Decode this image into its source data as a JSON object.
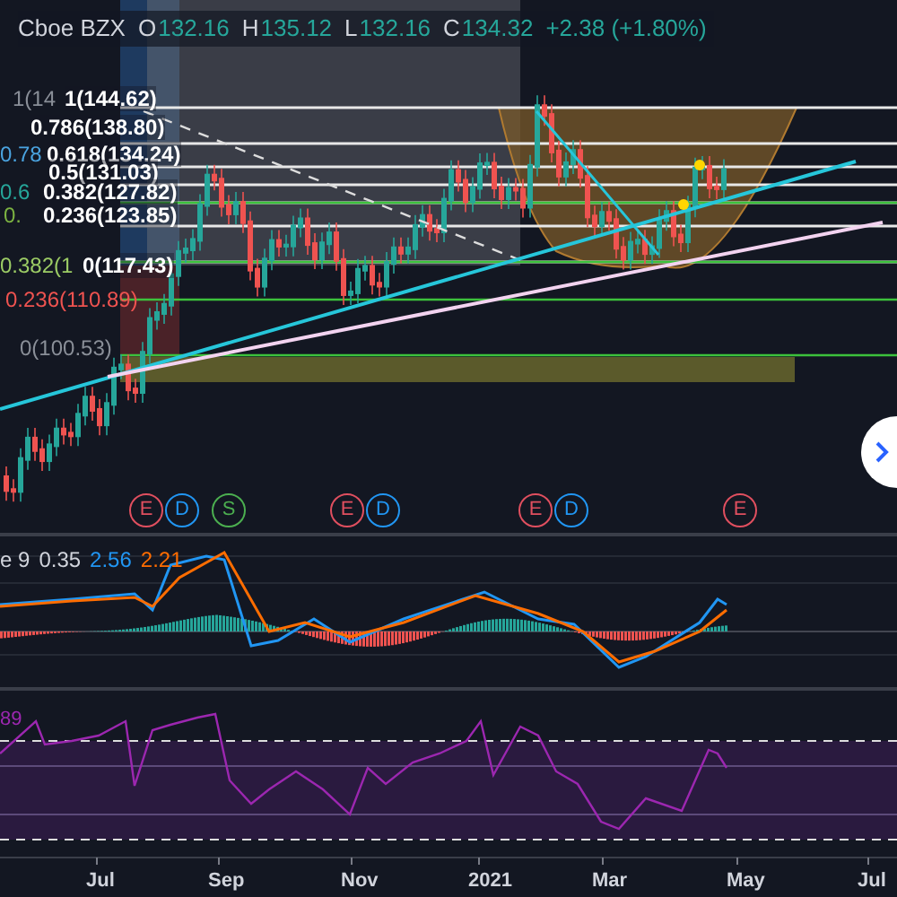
{
  "header": {
    "exchange": "Cboe BZX",
    "ohlc": [
      {
        "key": "O",
        "value": "132.16"
      },
      {
        "key": "H",
        "value": "135.12"
      },
      {
        "key": "L",
        "value": "132.16"
      },
      {
        "key": "C",
        "value": "134.32"
      }
    ],
    "change": "+2.38 (+1.80%)"
  },
  "fib_primary": [
    "1(144.62)",
    "0.786(138.80)",
    "0.618(134.24)",
    "0.5(131.03)",
    "0.382(127.82)",
    "0.236(123.85)",
    "0(117.43)"
  ],
  "fib_secondary": [
    {
      "label": "1(14",
      "color": "#8a8f98"
    },
    {
      "label": "0.78",
      "color": "#4aa3df"
    },
    {
      "label": "0.6",
      "color": "#26a69a"
    },
    {
      "label": "0.",
      "color": "#7cb342"
    },
    {
      "label": "0.382(1",
      "color": "#9ccc65"
    },
    {
      "label": "0.236(110.89)",
      "color": "#ef5350"
    },
    {
      "label": "0(100.53)",
      "color": "#8a8f98"
    }
  ],
  "events": [
    {
      "letter": "E",
      "color": "#e04f5f"
    },
    {
      "letter": "D",
      "color": "#2196f3"
    },
    {
      "letter": "S",
      "color": "#4caf50"
    },
    {
      "letter": "E",
      "color": "#e04f5f"
    },
    {
      "letter": "D",
      "color": "#2196f3"
    },
    {
      "letter": "E",
      "color": "#e04f5f"
    },
    {
      "letter": "D",
      "color": "#2196f3"
    },
    {
      "letter": "E",
      "color": "#e04f5f"
    }
  ],
  "macd": {
    "label": "e 9",
    "values": [
      {
        "text": "0.35",
        "color": "#d1d4dc"
      },
      {
        "text": "2.56",
        "color": "#2196f3"
      },
      {
        "text": "2.21",
        "color": "#ff6d00"
      }
    ]
  },
  "rsi": {
    "value": "89"
  },
  "x_axis": [
    "Jul",
    "Sep",
    "Nov",
    "2021",
    "Mar",
    "May",
    "Jul"
  ]
}
